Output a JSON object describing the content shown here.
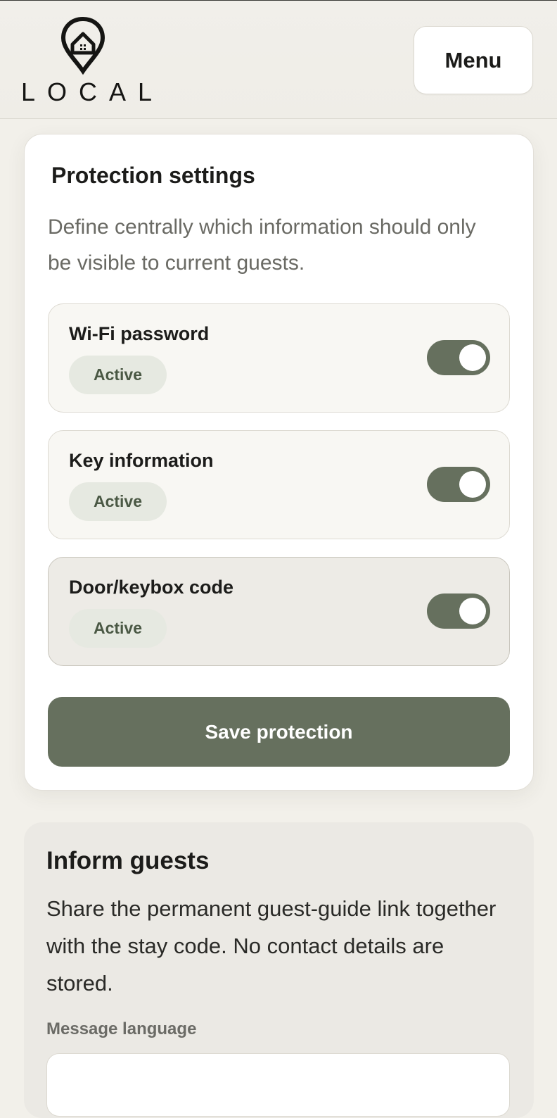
{
  "header": {
    "logo_text": "LOCAL",
    "menu_label": "Menu"
  },
  "protection": {
    "title": "Protection settings",
    "description": "Define centrally which information should only be visible to current guests.",
    "items": [
      {
        "label": "Wi-Fi password",
        "status": "Active",
        "enabled": true
      },
      {
        "label": "Key information",
        "status": "Active",
        "enabled": true
      },
      {
        "label": "Door/keybox code",
        "status": "Active",
        "enabled": true
      }
    ],
    "save_label": "Save protection"
  },
  "inform": {
    "title": "Inform guests",
    "description": "Share the permanent guest-guide link together with the stay code. No contact details are stored.",
    "language_label": "Message language"
  },
  "colors": {
    "accent": "#66705e",
    "badge_bg": "#e6e9e1",
    "page_bg": "#f2f0ea"
  }
}
